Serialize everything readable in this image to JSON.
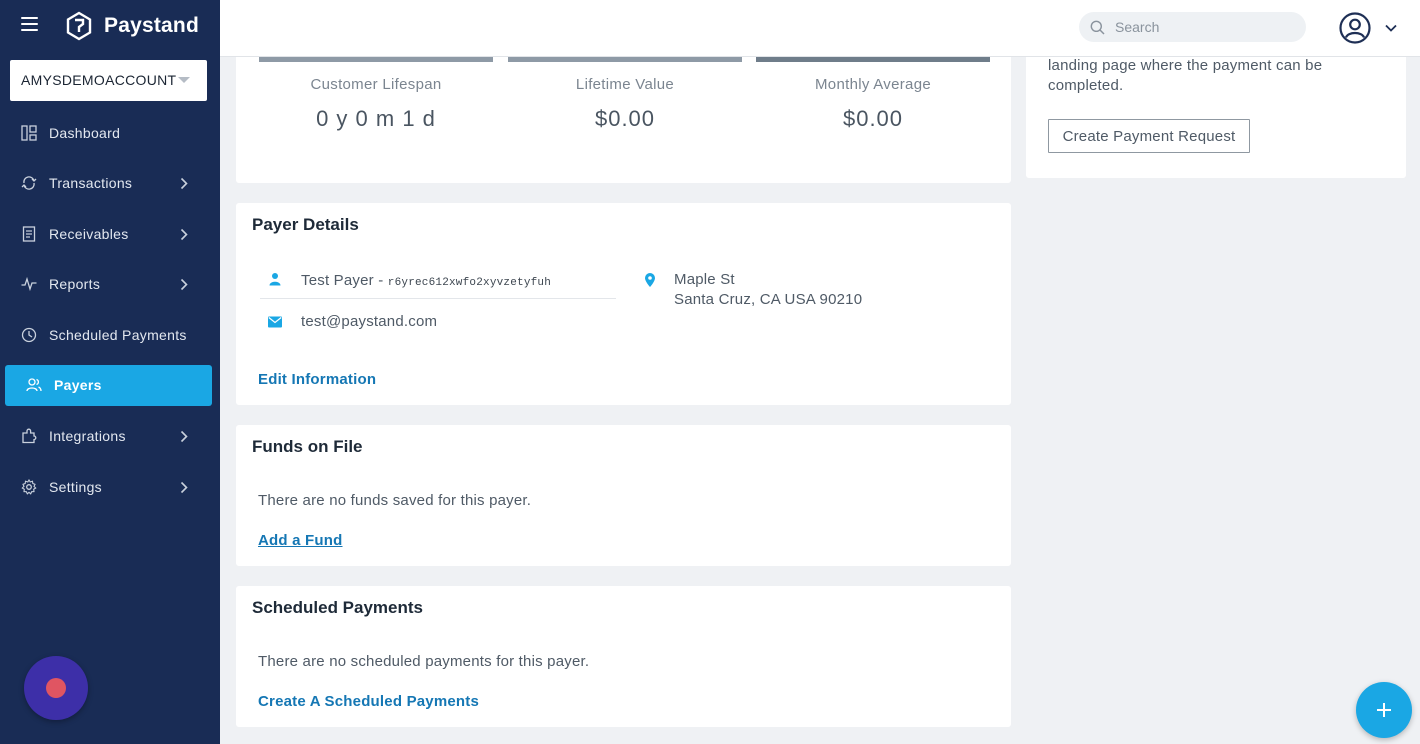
{
  "brand": {
    "name": "Paystand",
    "accent": "#1aa7e4",
    "sidebar_bg": "#192c55"
  },
  "account": {
    "selected": "AMYSDEMOACCOUNT"
  },
  "nav": [
    {
      "label": "Dashboard",
      "icon": "dashboard-icon",
      "has_children": false,
      "active": false
    },
    {
      "label": "Transactions",
      "icon": "transactions-icon",
      "has_children": true,
      "active": false
    },
    {
      "label": "Receivables",
      "icon": "receivables-icon",
      "has_children": true,
      "active": false
    },
    {
      "label": "Reports",
      "icon": "reports-icon",
      "has_children": true,
      "active": false
    },
    {
      "label": "Scheduled Payments",
      "icon": "clock-icon",
      "has_children": false,
      "active": false
    },
    {
      "label": "Payers",
      "icon": "users-icon",
      "has_children": false,
      "active": true
    },
    {
      "label": "Integrations",
      "icon": "integrations-icon",
      "has_children": true,
      "active": false
    },
    {
      "label": "Settings",
      "icon": "gear-icon",
      "has_children": true,
      "active": false
    }
  ],
  "search": {
    "placeholder": "Search",
    "value": ""
  },
  "stats": [
    {
      "label": "Customer Lifespan",
      "value": "0 y 0 m 1 d"
    },
    {
      "label": "Lifetime Value",
      "value": "$0.00"
    },
    {
      "label": "Monthly Average",
      "value": "$0.00"
    }
  ],
  "payer_details": {
    "title": "Payer Details",
    "name": "Test Payer - ",
    "payer_id": "r6yrec612xwfo2xyvzetyfuh",
    "email": "test@paystand.com",
    "address_line1": "Maple St",
    "address_line2": "Santa Cruz, CA USA 90210",
    "edit_label": "Edit Information"
  },
  "funds": {
    "title": "Funds on File",
    "empty_text": "There are no funds saved for this payer.",
    "add_label": "Add a Fund"
  },
  "scheduled": {
    "title": "Scheduled Payments",
    "empty_text": "There are no scheduled payments for this payer.",
    "create_label": "Create A Scheduled Payments"
  },
  "payment_request": {
    "desc_line1": "landing page where the payment can be",
    "desc_line2": "completed.",
    "button_label": "Create Payment Request"
  }
}
